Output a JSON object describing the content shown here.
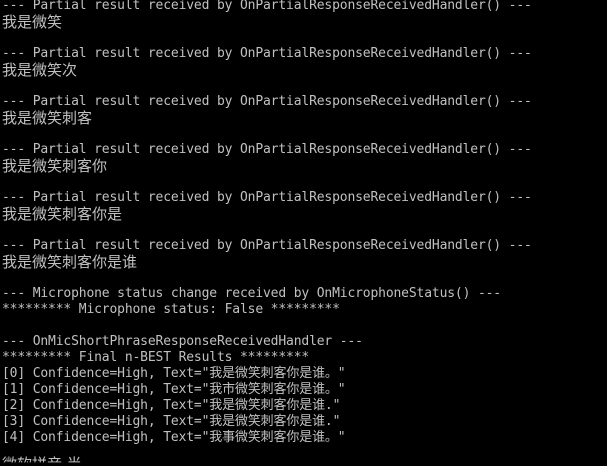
{
  "console": {
    "text_color": "#c0c0c0",
    "background": "#000000",
    "blocks": [
      {
        "header": "--- Partial result received by OnPartialResponseReceivedHandler() ---",
        "text": "我是微笑"
      },
      {
        "header": "--- Partial result received by OnPartialResponseReceivedHandler() ---",
        "text": "我是微笑次"
      },
      {
        "header": "--- Partial result received by OnPartialResponseReceivedHandler() ---",
        "text": "我是微笑刺客"
      },
      {
        "header": "--- Partial result received by OnPartialResponseReceivedHandler() ---",
        "text": "我是微笑刺客你"
      },
      {
        "header": "--- Partial result received by OnPartialResponseReceivedHandler() ---",
        "text": "我是微笑刺客你是"
      },
      {
        "header": "--- Partial result received by OnPartialResponseReceivedHandler() ---",
        "text": "我是微笑刺客你是谁"
      }
    ],
    "mic_header": "--- Microphone status change received by OnMicrophoneStatus() ---",
    "mic_status": "********* Microphone status: False *********",
    "final_header": "--- OnMicShortPhraseResponseReceivedHandler ---",
    "final_title": "********* Final n-BEST Results *********",
    "results": [
      "[0] Confidence=High, Text=\"我是微笑刺客你是谁。\"",
      "[1] Confidence=High, Text=\"我市微笑刺客你是谁。\"",
      "[2] Confidence=High, Text=\"我是微笑刺客你是谁.\"",
      "[3] Confidence=High, Text=\"我是微笑刺客你是谁.\"",
      "[4] Confidence=High, Text=\"我事微笑刺客你是谁。\""
    ],
    "partial_bottom": "微软拼音 半"
  }
}
